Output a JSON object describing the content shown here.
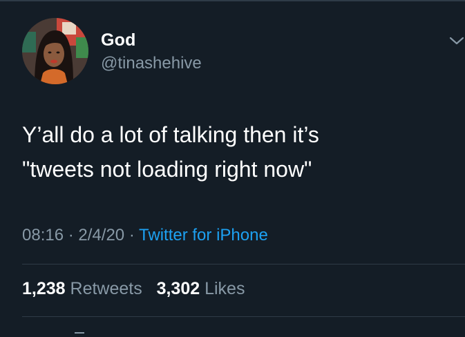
{
  "tweet": {
    "author": {
      "display_name": "God",
      "handle": "@tinashehive"
    },
    "text_lines": [
      "Y’all do a lot of talking then it’s",
      "\"tweets not loading right now\""
    ],
    "time": "08:16",
    "date": "2/4/20",
    "separator": "·",
    "source": "Twitter for iPhone",
    "retweets": {
      "count": "1,238",
      "label": "Retweets"
    },
    "likes": {
      "count": "3,302",
      "label": "Likes"
    }
  },
  "colors": {
    "background": "#141d26",
    "secondary_text": "#8899a6",
    "link": "#1da1f2",
    "divider": "#2f3b47"
  },
  "icons": {
    "more": "chevron-down-icon"
  }
}
